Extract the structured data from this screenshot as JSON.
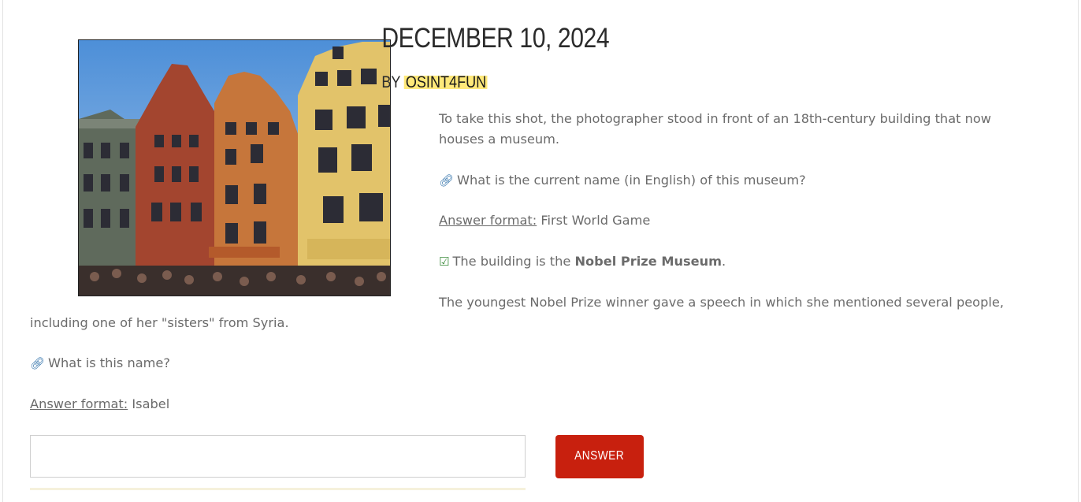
{
  "post": {
    "date": "DECEMBER 10, 2024",
    "by_label": "BY ",
    "author": "OSINT4FUN"
  },
  "image": {
    "description_icon": "photo-stockholm-facades"
  },
  "body": {
    "p1": "To take this shot, the photographer stood in front of an 18th-century building that now houses a museum.",
    "q1": "What is the current name (in English) of this museum?",
    "format1_label": "Answer format:",
    "format1_value": " First World Game",
    "answer1_prefix": "The building is the ",
    "answer1_bold": "Nobel Prize Museum",
    "answer1_suffix": ".",
    "p2": "The youngest Nobel Prize winner gave a speech in which she mentioned several people, including one of her \"sisters\" from Syria.",
    "q2": "What is this name?",
    "format2_label": "Answer format:",
    "format2_value": " Isabel"
  },
  "form": {
    "input_value": "",
    "input_placeholder": "",
    "button_label": "ANSWER"
  },
  "colors": {
    "accent_button": "#c8200e",
    "author_highlight": "#ffe97a",
    "link_icon": "#2b6ea8",
    "check_icon": "#3d8c3d"
  },
  "icons": {
    "question": "link-icon",
    "solved": "check-square-icon"
  }
}
